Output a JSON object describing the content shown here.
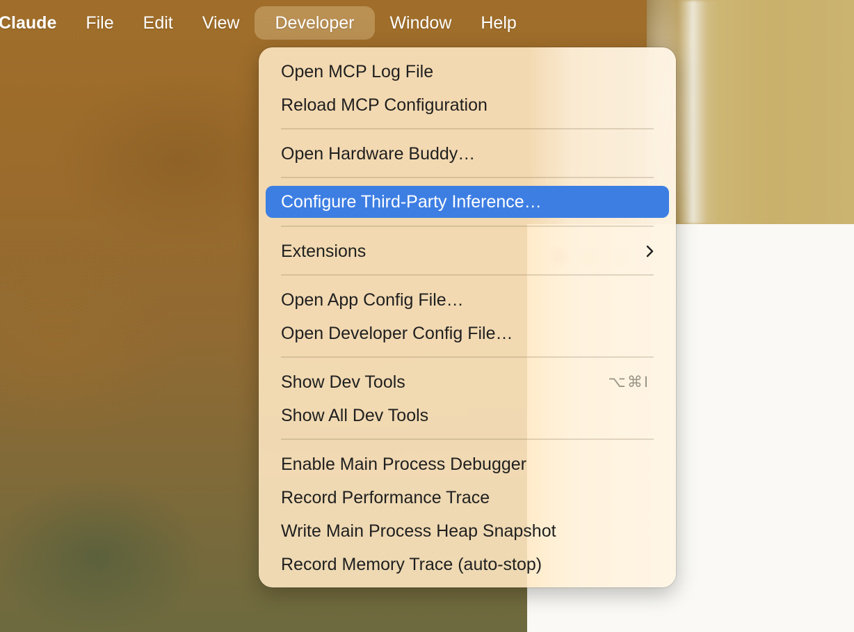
{
  "menubar": {
    "app_name": "Claude",
    "items": [
      "File",
      "Edit",
      "View",
      "Developer",
      "Window",
      "Help"
    ],
    "active_item": "Developer"
  },
  "developer_menu": {
    "items": [
      {
        "label": "Open MCP Log File"
      },
      {
        "label": "Reload MCP Configuration"
      },
      {
        "label": "Open Hardware Buddy…"
      },
      {
        "label": "Configure Third-Party Inference…",
        "highlighted": true
      },
      {
        "label": "Extensions",
        "submenu": true
      },
      {
        "label": "Open App Config File…"
      },
      {
        "label": "Open Developer Config File…"
      },
      {
        "label": "Show Dev Tools",
        "shortcut": "⌥⌘I"
      },
      {
        "label": "Show All Dev Tools"
      },
      {
        "label": "Enable Main Process Debugger"
      },
      {
        "label": "Record Performance Trace"
      },
      {
        "label": "Write Main Process Heap Snapshot"
      },
      {
        "label": "Record Memory Trace (auto-stop)"
      }
    ]
  },
  "colors": {
    "highlight": "#3d7ee3",
    "menu_background": "#ffe8c4",
    "menu_text": "#1f1f1f"
  },
  "icons": {
    "submenu": "chevron-right-icon"
  }
}
